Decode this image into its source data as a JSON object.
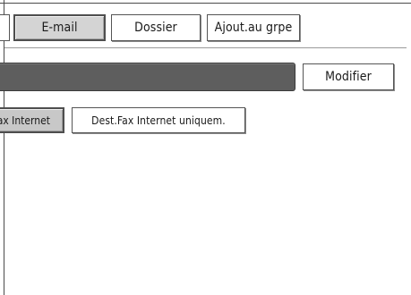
{
  "tabs": {
    "email": "E-mail",
    "folder": "Dossier",
    "add_group": "Ajout.au grpe"
  },
  "name_row": {
    "name_value": "",
    "modify_button": "Modifier"
  },
  "fax_options": {
    "internet_fax": "Fax Internet",
    "internet_fax_only": "Dest.Fax Internet uniquem."
  },
  "colors": {
    "active_tab_bg": "#d4d4d4",
    "field_bg": "#5e5e5e"
  }
}
